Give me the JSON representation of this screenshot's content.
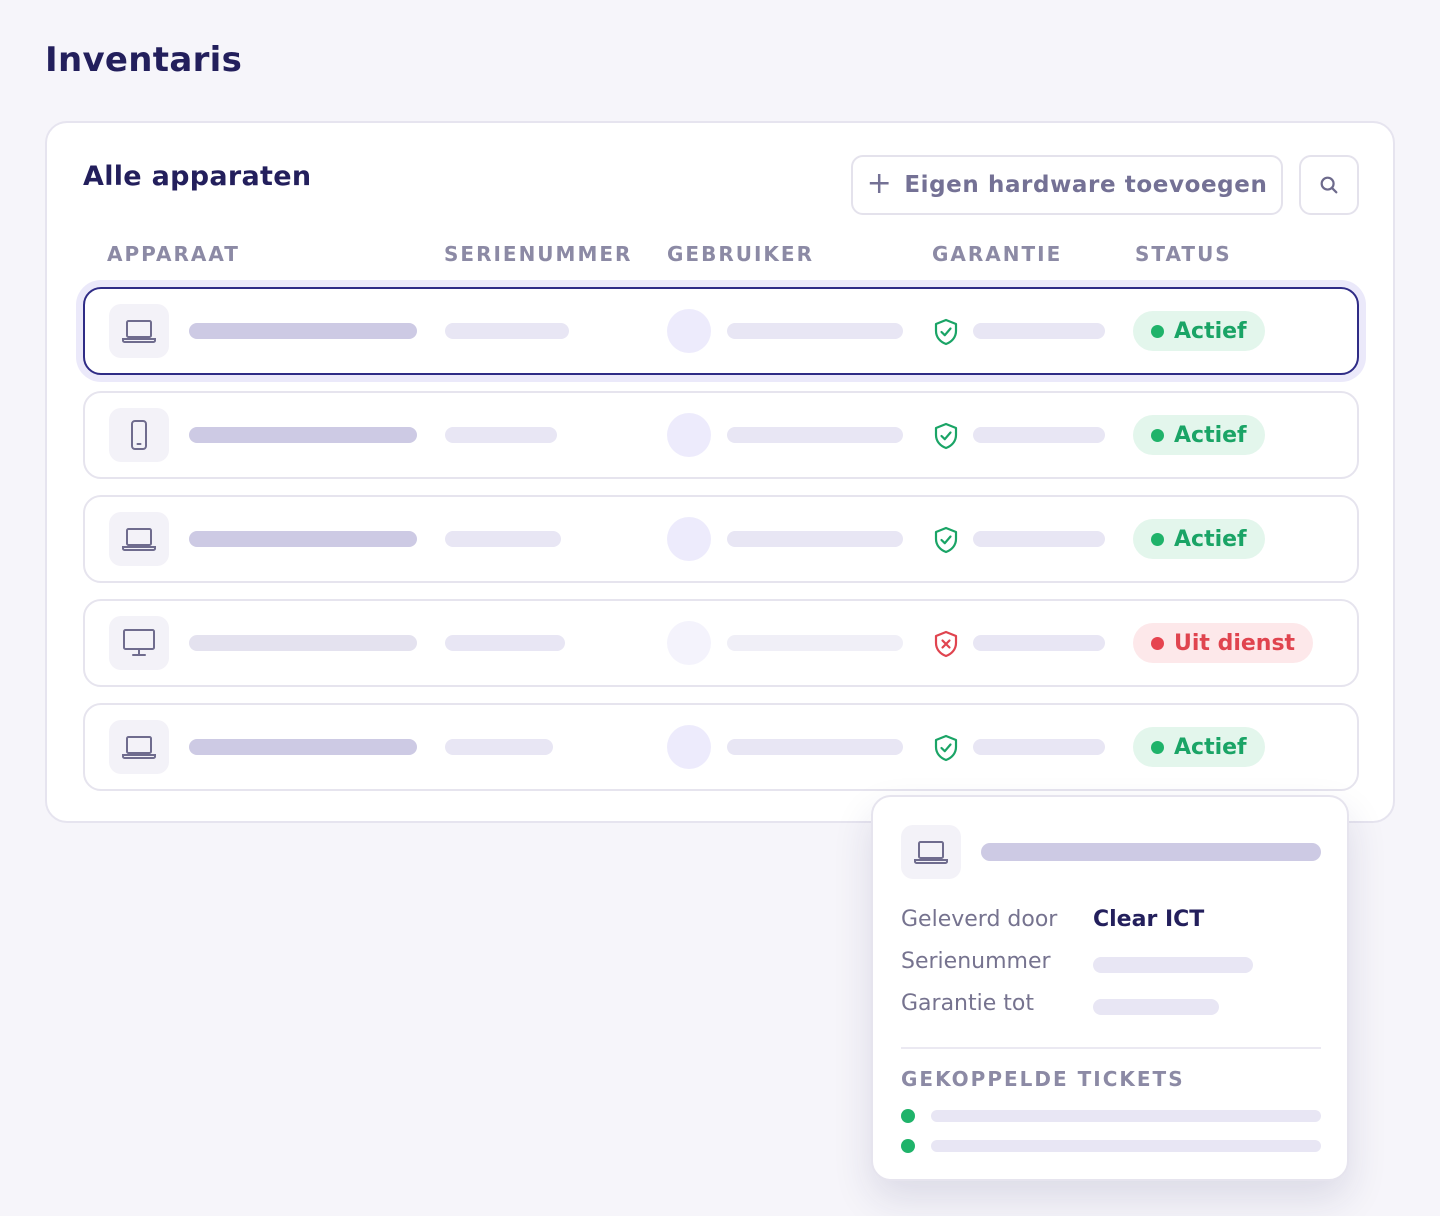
{
  "page": {
    "title": "Inventaris"
  },
  "card": {
    "title": "Alle apparaten",
    "add_button_label": "Eigen hardware toevoegen",
    "add_button_icon": "plus-icon",
    "search_button_icon": "search-icon"
  },
  "columns": [
    "APPARAAT",
    "SERIENUMMER",
    "GEBRUIKER",
    "GARANTIE",
    "STATUS"
  ],
  "rows": [
    {
      "device_icon": "laptop-icon",
      "warranty_icon": "shield-check-icon",
      "status": "Actief",
      "status_type": "active",
      "selected": true
    },
    {
      "device_icon": "phone-icon",
      "warranty_icon": "shield-check-icon",
      "status": "Actief",
      "status_type": "active",
      "selected": false
    },
    {
      "device_icon": "laptop-icon",
      "warranty_icon": "shield-check-icon",
      "status": "Actief",
      "status_type": "active",
      "selected": false
    },
    {
      "device_icon": "monitor-icon",
      "warranty_icon": "shield-x-icon",
      "status": "Uit dienst",
      "status_type": "out",
      "selected": false
    },
    {
      "device_icon": "laptop-icon",
      "warranty_icon": "shield-check-icon",
      "status": "Actief",
      "status_type": "active",
      "selected": false
    }
  ],
  "detail": {
    "device_icon": "laptop-icon",
    "supplier_label": "Geleverd door",
    "supplier_value": "Clear ICT",
    "serial_label": "Serienummer",
    "warranty_label": "Garantie tot",
    "tickets_title": "GEKOPPELDE TICKETS"
  },
  "colors": {
    "primary": "#231f5c",
    "active_green": "#1aa466",
    "out_red": "#e0444f",
    "background": "#f6f5fa"
  }
}
